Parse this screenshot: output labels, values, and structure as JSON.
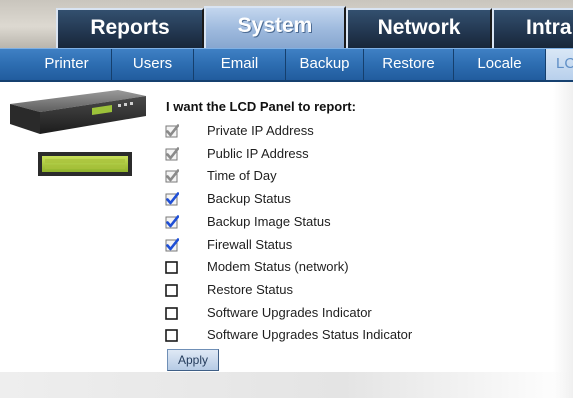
{
  "top_tabs": [
    {
      "label": "Reports",
      "active": false
    },
    {
      "label": "System",
      "active": true
    },
    {
      "label": "Network",
      "active": false
    },
    {
      "label": "Intra",
      "active": false
    }
  ],
  "sub_tabs": [
    {
      "label": "Printer",
      "active": false
    },
    {
      "label": "Users",
      "active": false
    },
    {
      "label": "Email",
      "active": false
    },
    {
      "label": "Backup",
      "active": false
    },
    {
      "label": "Restore",
      "active": false
    },
    {
      "label": "Locale",
      "active": false
    },
    {
      "label": "LC",
      "active": true
    }
  ],
  "lcd": {
    "heading": "I want the LCD Panel to report:",
    "options": [
      {
        "label": "Private IP Address",
        "state": "checked-disabled"
      },
      {
        "label": "Public IP Address",
        "state": "checked-disabled"
      },
      {
        "label": "Time of Day",
        "state": "checked-disabled"
      },
      {
        "label": "Backup Status",
        "state": "checked"
      },
      {
        "label": "Backup Image Status",
        "state": "checked"
      },
      {
        "label": "Firewall Status",
        "state": "checked"
      },
      {
        "label": "Modem Status (network)",
        "state": "unchecked"
      },
      {
        "label": "Restore Status",
        "state": "unchecked"
      },
      {
        "label": "Software Upgrades Indicator",
        "state": "unchecked"
      },
      {
        "label": "Software Upgrades Status Indicator",
        "state": "unchecked"
      }
    ],
    "apply_label": "Apply"
  },
  "colors": {
    "tab_dark": "#22364f",
    "tab_active": "#9db9dd",
    "subbar": "#2d6db1",
    "check_blue": "#1f4fd6",
    "check_grey": "#8a8a8a"
  }
}
